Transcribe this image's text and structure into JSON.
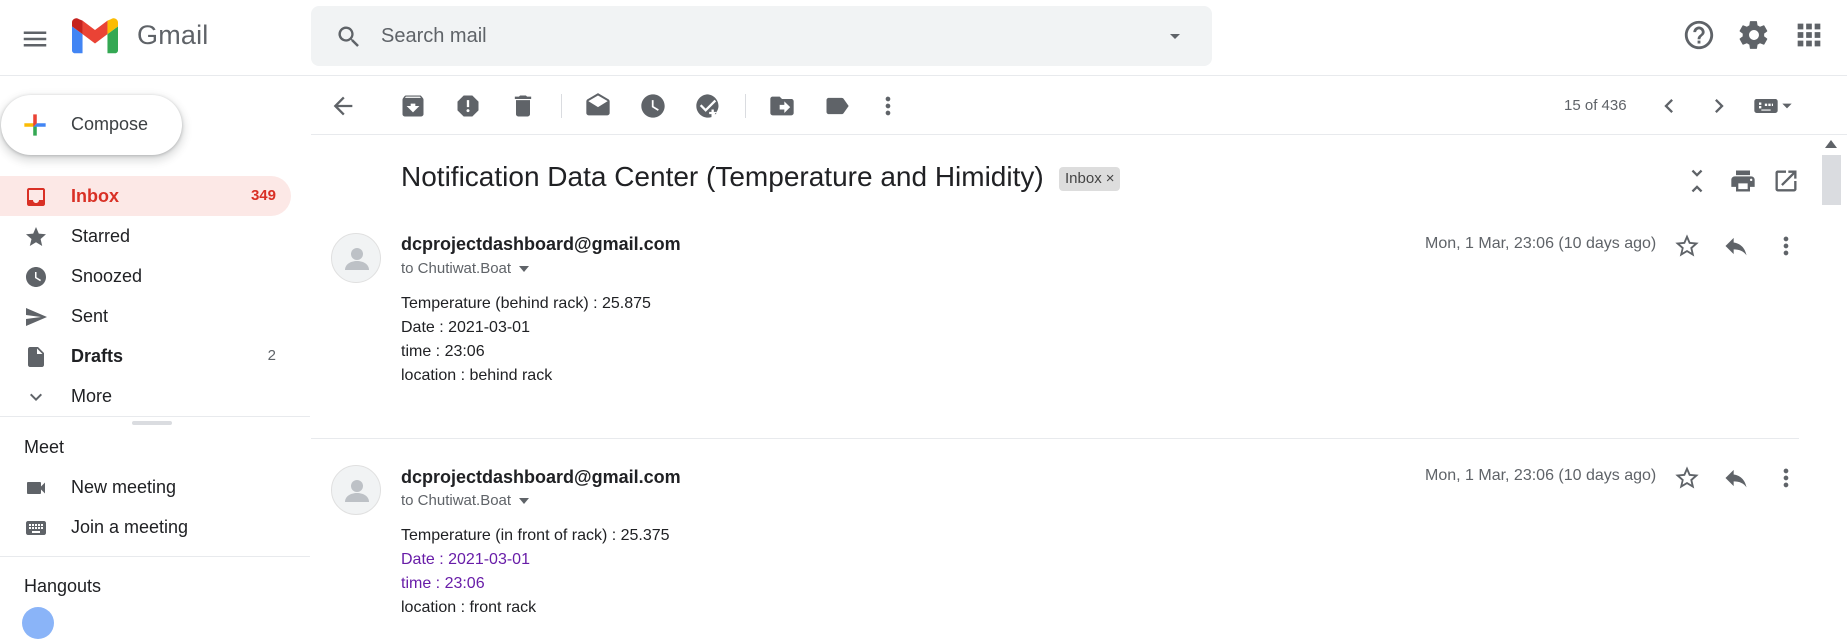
{
  "app": {
    "brand": "Gmail"
  },
  "search": {
    "placeholder": "Search mail"
  },
  "sidebar": {
    "compose_label": "Compose",
    "items": [
      {
        "label": "Inbox",
        "count": "349",
        "icon": "inbox-icon"
      },
      {
        "label": "Starred",
        "count": "",
        "icon": "star-icon"
      },
      {
        "label": "Snoozed",
        "count": "",
        "icon": "clock-icon"
      },
      {
        "label": "Sent",
        "count": "",
        "icon": "send-icon"
      },
      {
        "label": "Drafts",
        "count": "2",
        "icon": "draft-icon"
      },
      {
        "label": "More",
        "count": "",
        "icon": "chevron-down-icon"
      }
    ],
    "meet": {
      "title": "Meet",
      "new_meeting": "New meeting",
      "join_meeting": "Join a meeting"
    },
    "hangouts": {
      "title": "Hangouts"
    }
  },
  "toolbar": {
    "pager": "15 of 436"
  },
  "thread": {
    "subject": "Notification Data Center (Temperature and Himidity)",
    "label_badge": "Inbox",
    "messages": [
      {
        "sender": "dcprojectdashboard@gmail.com",
        "to": "to Chutiwat.Boat",
        "date": "Mon, 1 Mar, 23:06 (10 days ago)",
        "lines": [
          "Temperature (behind rack) : 25.875",
          "Date : 2021-03-01",
          "time : 23:06",
          "location : behind rack"
        ]
      },
      {
        "sender": "dcprojectdashboard@gmail.com",
        "to": "to Chutiwat.Boat",
        "date": "Mon, 1 Mar, 23:06 (10 days ago)",
        "lines": [
          "Temperature (in front of rack) : 25.375",
          "Date : 2021-03-01",
          "time : 23:06",
          "location : front rack"
        ]
      }
    ]
  },
  "colors": {
    "accent_red": "#d93025",
    "active_bg": "#fce8e6",
    "visited_link": "#681da8"
  }
}
